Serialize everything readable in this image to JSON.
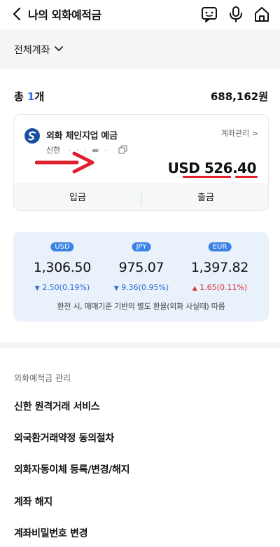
{
  "header": {
    "title": "나의 외화예적금",
    "icons": [
      "back-icon",
      "chat-bot-icon",
      "microphone-icon",
      "home-icon"
    ]
  },
  "filter": {
    "label": "전체계좌",
    "icon": "chevron-down-icon"
  },
  "summary": {
    "prefix": "총 ",
    "count": "1",
    "suffix": "개",
    "total": "688,162원"
  },
  "account": {
    "name": "외화 체인지업 예금",
    "bank": "신한",
    "number_masked": "·  · ·  ▬ ·",
    "manage_label": "계좌관리 >",
    "balance": "USD 526.40",
    "deposit_label": "입금",
    "withdraw_label": "출금"
  },
  "rates": {
    "items": [
      {
        "currency": "USD",
        "value": "1,306.50",
        "change": "2.50(0.19%)",
        "direction": "down"
      },
      {
        "currency": "JPY",
        "value": "975.07",
        "change": "9.36(0.95%)",
        "direction": "down"
      },
      {
        "currency": "EUR",
        "value": "1,397.82",
        "change": "1.65(0.11%)",
        "direction": "up"
      }
    ],
    "note": "환전 시, 매매기준 기반의 별도 환율(외화 사실때) 따름"
  },
  "menu": {
    "heading": "외화예적금 관리",
    "items": [
      "신한 원격거래 서비스",
      "외국환거래약정 동의절차",
      "외화자동이체 등록/변경/해지",
      "계좌 해지",
      "계좌비밀번호 변경"
    ]
  },
  "colors": {
    "accent": "#2f6fe4",
    "rate_badge": "#3b82e6",
    "rate_panel_bg": "#e9f1fb",
    "down": "#2b6bd6",
    "up": "#d9323c",
    "annotation_red": "#e0202d"
  }
}
